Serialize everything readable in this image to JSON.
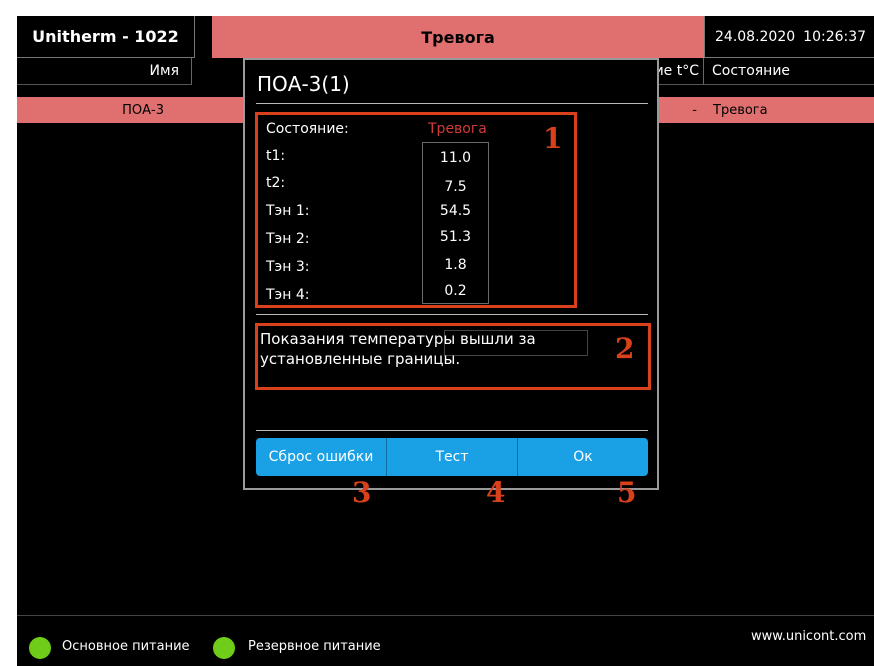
{
  "header": {
    "title": "Unitherm - 1022",
    "alarm": "Тревога",
    "date": "24.08.2020",
    "time": "10:26:37"
  },
  "table": {
    "columns": {
      "name": "Имя",
      "temp": "ие t°C",
      "state": "Состояние"
    },
    "rows": [
      {
        "name": "ПОА-3",
        "temp": "-",
        "state": "Тревога"
      }
    ]
  },
  "dialog": {
    "title": "ПОА-3(1)",
    "state_label": "Состояние:",
    "state_value": "Тревога",
    "params": [
      {
        "label": "t1:",
        "value": "11.0"
      },
      {
        "label": "t2:",
        "value": "7.5"
      },
      {
        "label": "Тэн 1:",
        "value": "54.5"
      },
      {
        "label": "Тэн 2:",
        "value": "51.3"
      },
      {
        "label": "Тэн 3:",
        "value": "1.8"
      },
      {
        "label": "Тэн 4:",
        "value": "0.2"
      }
    ],
    "message": "Показания температуры вышли за установленные границы.",
    "buttons": {
      "reset": "Сброс ошибки",
      "test": "Тест",
      "ok": "Ок"
    }
  },
  "annotations": [
    "1",
    "2",
    "3",
    "4",
    "5"
  ],
  "footer": {
    "main_power": "Основное питание",
    "backup_power": "Резервное питание",
    "url": "www.unicont.com"
  },
  "colors": {
    "alarm": "#e07070",
    "button": "#1aa1e5",
    "annotation": "#d9401c",
    "power_ok": "#6fcd1a"
  }
}
